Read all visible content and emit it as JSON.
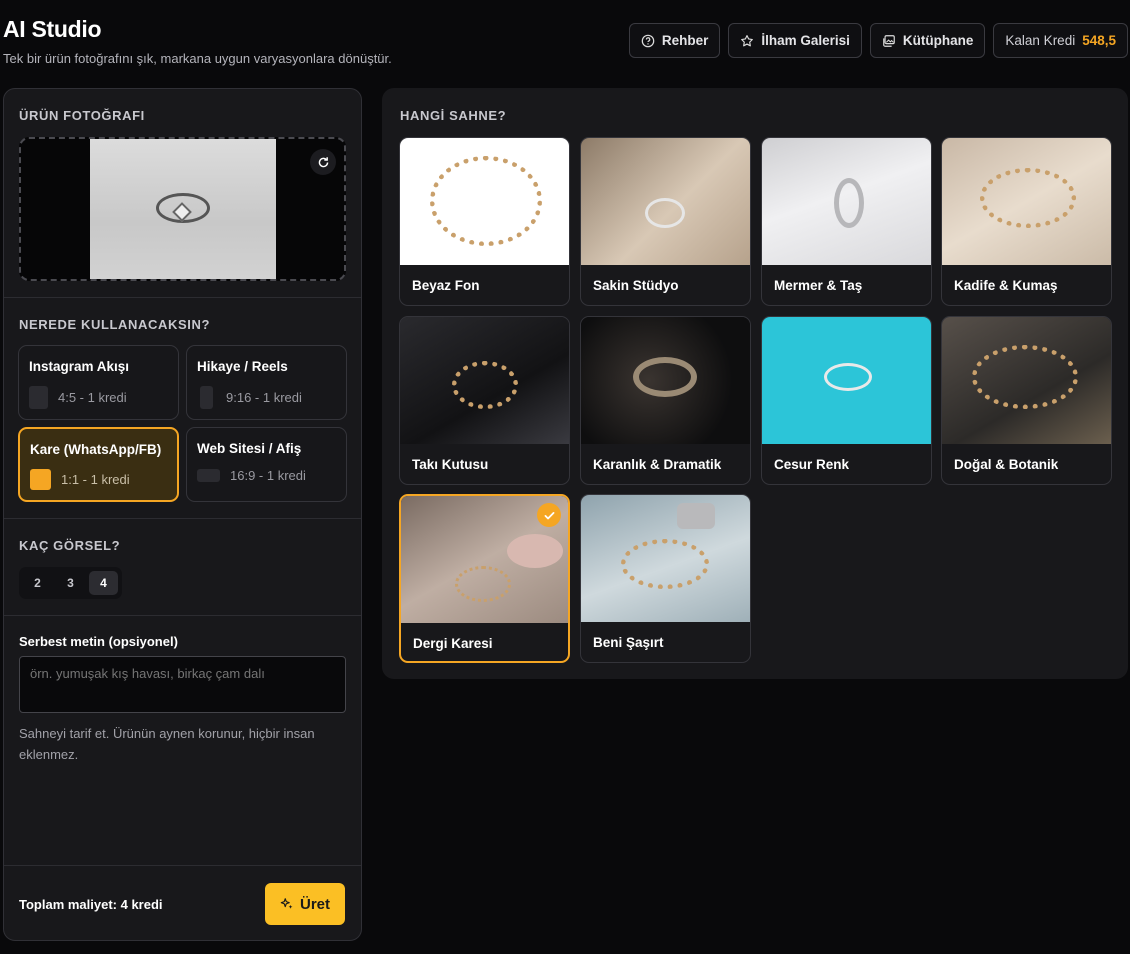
{
  "header": {
    "title": "AI Studio",
    "subtitle": "Tek bir ürün fotoğrafını şık, markana uygun varyasyonlara dönüştür.",
    "buttons": {
      "guide": "Rehber",
      "inspiration": "İlham Galerisi",
      "library": "Kütüphane"
    },
    "credit_label": "Kalan Kredi",
    "credit_value": "548,5"
  },
  "left": {
    "photo_label": "ÜRÜN FOTOĞRAFI",
    "use_label": "NEREDE KULLANACAKSIN?",
    "use_options": [
      {
        "name": "Instagram Akışı",
        "meta": "4:5 - 1 kredi",
        "selected": false
      },
      {
        "name": "Hikaye / Reels",
        "meta": "9:16 - 1 kredi",
        "selected": false
      },
      {
        "name": "Kare (WhatsApp/FB)",
        "meta": "1:1 - 1 kredi",
        "selected": true
      },
      {
        "name": "Web Sitesi / Afiş",
        "meta": "16:9 - 1 kredi",
        "selected": false
      }
    ],
    "count_label": "KAÇ GÖRSEL?",
    "counts": [
      "2",
      "3",
      "4"
    ],
    "selected_count": "4",
    "free_text_label": "Serbest metin (opsiyonel)",
    "free_text_placeholder": "örn. yumuşak kış havası, birkaç çam dalı",
    "hint": "Sahneyi tarif et. Ürünün aynen korunur, hiçbir insan eklenmez.",
    "total": "Toplam maliyet: 4 kredi",
    "generate": "Üret"
  },
  "right": {
    "scene_label": "HANGİ SAHNE?",
    "scenes": [
      {
        "name": "Beyaz Fon"
      },
      {
        "name": "Sakin Stüdyo"
      },
      {
        "name": "Mermer & Taş"
      },
      {
        "name": "Kadife & Kumaş"
      },
      {
        "name": "Takı Kutusu"
      },
      {
        "name": "Karanlık & Dramatik"
      },
      {
        "name": "Cesur Renk"
      },
      {
        "name": "Doğal & Botanik"
      },
      {
        "name": "Dergi Karesi",
        "selected": true
      },
      {
        "name": "Beni Şaşırt"
      }
    ]
  },
  "colors": {
    "accent": "#f5a623",
    "button": "#fbbf24",
    "panel": "#18181b",
    "background": "#09090b"
  }
}
